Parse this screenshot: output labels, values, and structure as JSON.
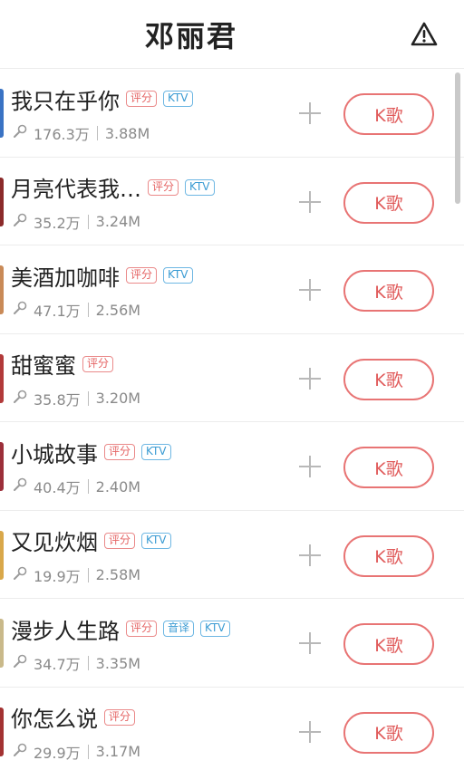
{
  "header": {
    "title": "邓丽君",
    "warning_icon": "warning-triangle-icon"
  },
  "colors": {
    "accent": "#e05a5a",
    "score_tag": "#e56464",
    "ktv_tag": "#3a9bd3",
    "meta_text": "#8a8a8a"
  },
  "songs": [
    {
      "title": "我只在乎你",
      "tags": [
        "评分",
        "KTV"
      ],
      "plays": "176.3万",
      "size": "3.88M",
      "button": "K歌",
      "cover_color": "#3a73c4"
    },
    {
      "title": "月亮代表我…",
      "tags": [
        "评分",
        "KTV"
      ],
      "plays": "35.2万",
      "size": "3.24M",
      "button": "K歌",
      "cover_color": "#8b2a2a"
    },
    {
      "title": "美酒加咖啡",
      "tags": [
        "评分",
        "KTV"
      ],
      "plays": "47.1万",
      "size": "2.56M",
      "button": "K歌",
      "cover_color": "#c98a57"
    },
    {
      "title": "甜蜜蜜",
      "tags": [
        "评分"
      ],
      "plays": "35.8万",
      "size": "3.20M",
      "button": "K歌",
      "cover_color": "#b23a3a"
    },
    {
      "title": "小城故事",
      "tags": [
        "评分",
        "KTV"
      ],
      "plays": "40.4万",
      "size": "2.40M",
      "button": "K歌",
      "cover_color": "#9c2f3a"
    },
    {
      "title": "又见炊烟",
      "tags": [
        "评分",
        "KTV"
      ],
      "plays": "19.9万",
      "size": "2.58M",
      "button": "K歌",
      "cover_color": "#d9a84a"
    },
    {
      "title": "漫步人生路",
      "tags": [
        "评分",
        "音译",
        "KTV"
      ],
      "plays": "34.7万",
      "size": "3.35M",
      "button": "K歌",
      "cover_color": "#c9b98a"
    },
    {
      "title": "你怎么说",
      "tags": [
        "评分"
      ],
      "plays": "29.9万",
      "size": "3.17M",
      "button": "K歌",
      "cover_color": "#a33232"
    }
  ]
}
